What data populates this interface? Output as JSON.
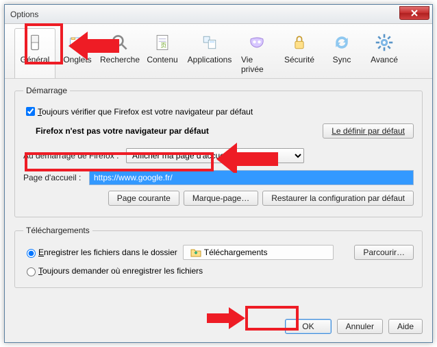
{
  "window": {
    "title": "Options"
  },
  "tabs": {
    "general": "Général",
    "onglets": "Onglets",
    "recherche": "Recherche",
    "contenu": "Contenu",
    "applications": "Applications",
    "vieprivee": "Vie privée",
    "securite": "Sécurité",
    "sync": "Sync",
    "avance": "Avancé"
  },
  "startup": {
    "legend": "Démarrage",
    "always_check": "Toujours vérifier que Firefox est votre navigateur par défaut",
    "not_default": "Firefox n'est pas votre navigateur par défaut",
    "set_default_btn": "Le définir par défaut",
    "on_start_label": "Au démarrage de Firefox :",
    "on_start_value": "Afficher ma page d'accueil",
    "homepage_label": "Page d'accueil :",
    "homepage_value": "https://www.google.fr/",
    "btn_current": "Page courante",
    "btn_bookmark": "Marque-page…",
    "btn_restore": "Restaurer la configuration par défaut"
  },
  "downloads": {
    "legend": "Téléchargements",
    "save_to_label": "Enregistrer les fichiers dans le dossier",
    "folder_name": "Téléchargements",
    "browse_btn": "Parcourir…",
    "always_ask": "Toujours demander où enregistrer les fichiers"
  },
  "footer": {
    "ok": "OK",
    "cancel": "Annuler",
    "help": "Aide"
  }
}
